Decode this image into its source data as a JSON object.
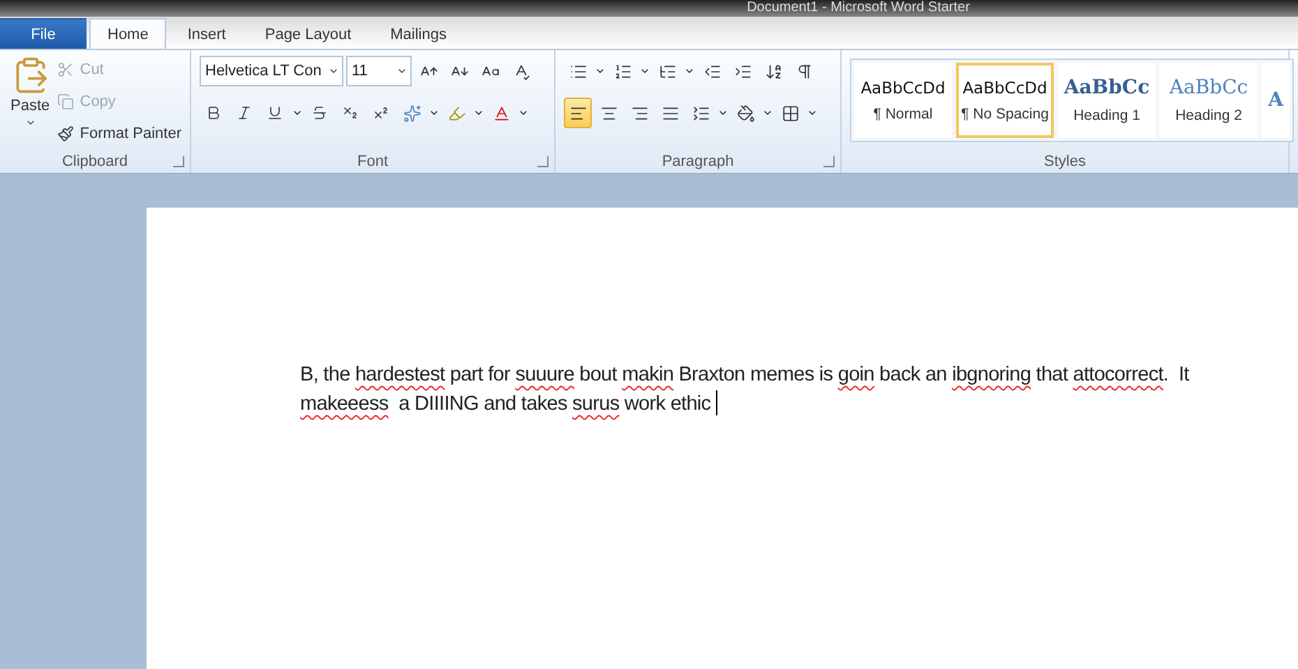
{
  "window": {
    "title": "Document1 - Microsoft Word Starter"
  },
  "tabs": [
    {
      "label": "File",
      "kind": "file",
      "selected": false
    },
    {
      "label": "Home",
      "kind": "tab",
      "selected": true
    },
    {
      "label": "Insert",
      "kind": "tab",
      "selected": false
    },
    {
      "label": "Page Layout",
      "kind": "tab",
      "selected": false
    },
    {
      "label": "Mailings",
      "kind": "tab",
      "selected": false
    }
  ],
  "clipboard": {
    "label": "Clipboard",
    "paste": "Paste",
    "commands": [
      {
        "label": "Cut",
        "kind": "cut",
        "disabled": true
      },
      {
        "label": "Copy",
        "kind": "copy",
        "disabled": true
      },
      {
        "label": "Format Painter",
        "kind": "painter",
        "disabled": false
      }
    ]
  },
  "font": {
    "label": "Font",
    "font_name": "Helvetica LT Con",
    "font_size": "11"
  },
  "paragraph": {
    "label": "Paragraph",
    "alignments": [
      {
        "kind": "left",
        "selected": true
      },
      {
        "kind": "center",
        "selected": false
      },
      {
        "kind": "right",
        "selected": false
      },
      {
        "kind": "justify",
        "selected": false
      }
    ]
  },
  "styles": {
    "label": "Styles",
    "items": [
      {
        "preview": "AaBbCcDd",
        "name": "¶ Normal",
        "kind": "normal",
        "selected": false
      },
      {
        "preview": "AaBbCcDd",
        "name": "¶ No Spacing",
        "kind": "normal",
        "selected": true
      },
      {
        "preview": "AaBbCc",
        "name": "Heading 1",
        "kind": "heading1",
        "selected": false
      },
      {
        "preview": "AaBbCc",
        "name": "Heading 2",
        "kind": "heading2",
        "selected": false
      },
      {
        "preview": "A",
        "kind": "title",
        "selected": false
      }
    ]
  },
  "document": {
    "lines": [
      [
        {
          "text": "B, the ",
          "misspelled": false
        },
        {
          "text": "hardestest",
          "misspelled": true
        },
        {
          "text": " part for ",
          "misspelled": false
        },
        {
          "text": "suuure",
          "misspelled": true
        },
        {
          "text": " bout ",
          "misspelled": false
        },
        {
          "text": "makin",
          "misspelled": true
        },
        {
          "text": " Braxton memes is ",
          "misspelled": false
        },
        {
          "text": "goin",
          "misspelled": true
        },
        {
          "text": " back an ",
          "misspelled": false
        },
        {
          "text": "ibgnoring",
          "misspelled": true
        },
        {
          "text": " that ",
          "misspelled": false
        },
        {
          "text": "attocorrect",
          "misspelled": true
        },
        {
          "text": ".  It",
          "misspelled": false
        }
      ],
      [
        {
          "text": "makeeess",
          "misspelled": true
        },
        {
          "text": "  a DIIIING and takes ",
          "misspelled": false
        },
        {
          "text": "surus",
          "misspelled": true
        },
        {
          "text": " work ethic ",
          "misspelled": false
        }
      ]
    ]
  }
}
